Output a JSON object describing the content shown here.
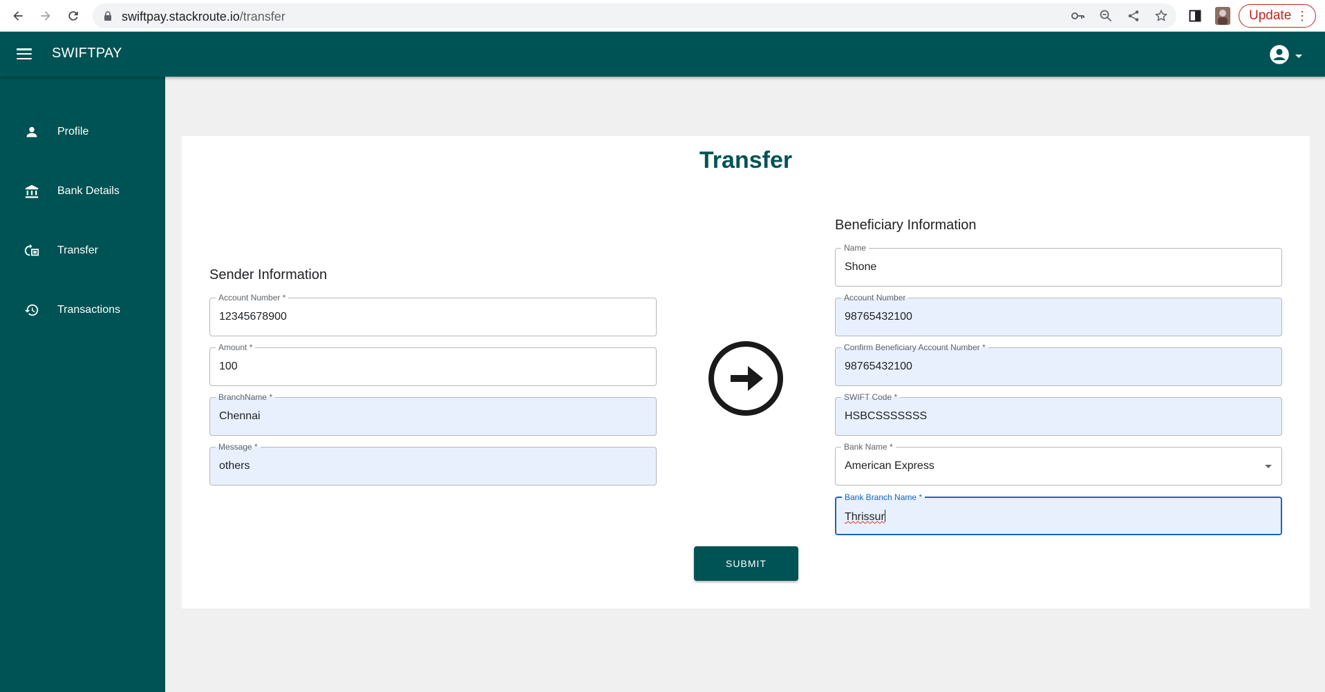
{
  "browser": {
    "url_domain": "swiftpay.stackroute.io",
    "url_path": "/transfer",
    "update_label": "Update"
  },
  "app": {
    "brand": "SWIFTPAY"
  },
  "sidebar": {
    "items": [
      {
        "label": "Profile",
        "icon": "person-icon"
      },
      {
        "label": "Bank Details",
        "icon": "bank-icon"
      },
      {
        "label": "Transfer",
        "icon": "transfer-icon"
      },
      {
        "label": "Transactions",
        "icon": "history-icon"
      }
    ]
  },
  "page": {
    "title": "Transfer"
  },
  "sender": {
    "title": "Sender Information",
    "account_number": {
      "label": "Account Number *",
      "value": "12345678900"
    },
    "amount": {
      "label": "Amount *",
      "value": "100"
    },
    "branch_name": {
      "label": "BranchName *",
      "value": "Chennai"
    },
    "message": {
      "label": "Message *",
      "value": "others"
    }
  },
  "beneficiary": {
    "title": "Beneficiary Information",
    "name": {
      "label": "Name",
      "value": "Shone"
    },
    "account_number": {
      "label": "Account Number",
      "value": "98765432100"
    },
    "confirm_account_number": {
      "label": "Confirm Beneficiary Account Number *",
      "value": "98765432100"
    },
    "swift_code": {
      "label": "SWIFT Code *",
      "value": "HSBCSSSSSSS"
    },
    "bank_name": {
      "label": "Bank Name *",
      "value": "American Express"
    },
    "bank_branch_name": {
      "label": "Bank Branch Name *",
      "value": "Thrissur"
    }
  },
  "actions": {
    "submit_label": "SUBMIT"
  },
  "colors": {
    "primary": "#005354",
    "background": "#f0f0f0",
    "autofill": "#e8f0fe",
    "focus": "#1565c0"
  }
}
